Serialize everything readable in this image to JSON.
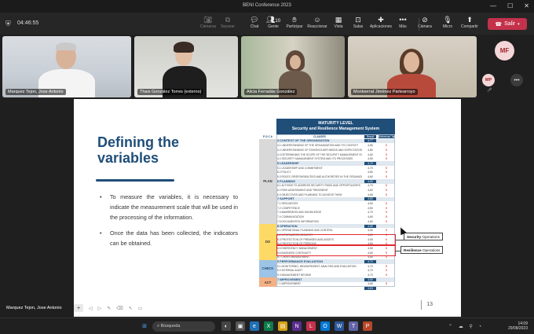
{
  "window": {
    "title": "BENI Conference 2023"
  },
  "toolbar": {
    "timer": "04:46:55",
    "items": [
      {
        "label": "Cámaras",
        "icon": "camera-icon"
      },
      {
        "label": "Separar",
        "icon": "pop-out-icon"
      },
      {
        "label": "Chat",
        "icon": "chat-icon"
      },
      {
        "label": "Gente",
        "icon": "people-icon",
        "count": "10"
      },
      {
        "label": "Participar",
        "icon": "raise-hand-icon"
      },
      {
        "label": "Reaccionar",
        "icon": "smile-icon"
      },
      {
        "label": "Vista",
        "icon": "grid-view-icon"
      },
      {
        "label": "Salas",
        "icon": "breakout-rooms-icon"
      },
      {
        "label": "Aplicaciones",
        "icon": "apps-icon"
      },
      {
        "label": "Más",
        "icon": "more-icon"
      },
      {
        "label": "Cámara",
        "icon": "camera-off-icon"
      },
      {
        "label": "Micro",
        "icon": "mic-off-icon"
      },
      {
        "label": "Compartir",
        "icon": "share-screen-icon"
      }
    ],
    "leave_label": "Salir"
  },
  "participants": [
    {
      "name": "Marquez Tejon, Jose Antonio"
    },
    {
      "name": "Thais González Torres (externo)"
    },
    {
      "name": "Alicia Ferradás González"
    },
    {
      "name": "Montserrat Jiménez Partearroyo"
    }
  ],
  "side_participants": [
    {
      "initials": "MF"
    },
    {
      "initials": "MP"
    }
  ],
  "slide": {
    "title_line1": "Defining the",
    "title_line2": "variables",
    "bullets": [
      "To measure the variables, it is necessary to indicate the measurement scale that will be used in the processing of the information.",
      "Once the data has been collected, the indicators can be obtained."
    ],
    "page_number": "13",
    "table": {
      "title_line1": "MATURITY LEVEL",
      "title_line2": "Security and Resilience Management System",
      "pdca_label": "P D C A",
      "clauses_label": "CLAUSES",
      "col1_label": "Result",
      "col2_label": "Reference Target",
      "phases": [
        "PLAN",
        "DO",
        "CHECK",
        "ACT"
      ],
      "rows": [
        {
          "type": "sec",
          "label": "4 CONTEXT OF THE ORGANIZATION",
          "v1": "4,77",
          "v2": ""
        },
        {
          "type": "row",
          "label": "4.1 UNDERSTANDING OF THE ORGANIZATION AND ITS CONTEXT",
          "v1": "4,80",
          "v2": "5"
        },
        {
          "type": "row",
          "label": "4.2 UNDERSTANDING OF STAKEHOLDER NEEDS AND EXPECTATIONS",
          "v1": "4,80",
          "v2": "5"
        },
        {
          "type": "row",
          "label": "4.3 DETERMINING THE SCOPE OF THE SECURITY MANAGEMENT SYSTEM",
          "v1": "4,60",
          "v2": "5"
        },
        {
          "type": "row",
          "label": "4.4 SECURITY MANAGEMENT SYSTEM AND ITS PROCESSES",
          "v1": "4,90",
          "v2": "5"
        },
        {
          "type": "sec",
          "label": "5 LEADERSHIP",
          "v1": "4,70",
          "v2": ""
        },
        {
          "type": "row",
          "label": "5.1 LEADERSHIP AND COMMITMENT",
          "v1": "4,70",
          "v2": "5"
        },
        {
          "type": "row",
          "label": "5.2 POLICY",
          "v1": "4,80",
          "v2": "5"
        },
        {
          "type": "row",
          "label": "5.3 ROLES, RESPONSIBILITIES AND AUTHORITIES IN THE ORGANIZATION",
          "v1": "4,60",
          "v2": "5"
        },
        {
          "type": "sec",
          "label": "6 PLANNING",
          "v1": "4,65",
          "v2": ""
        },
        {
          "type": "row",
          "label": "6.1 ACTIONS TO ADDRESS SECURITY RISKS AND OPPORTUNITIES",
          "v1": "4,70",
          "v2": "5"
        },
        {
          "type": "row",
          "label": "6.2 RISK ASSESSMENT AND TREATMENT",
          "v1": "4,60",
          "v2": "5"
        },
        {
          "type": "row",
          "label": "6.3 OBJECTIVES AND PLANNING TO ACHIEVE THEM",
          "v1": "4,65",
          "v2": "5"
        },
        {
          "type": "sec",
          "label": "7 SUPPORT",
          "v1": "4,60",
          "v2": ""
        },
        {
          "type": "row",
          "label": "7.1 RESOURCES",
          "v1": "4,60",
          "v2": "5"
        },
        {
          "type": "row",
          "label": "7.2 COMPETENCE",
          "v1": "4,50",
          "v2": "5"
        },
        {
          "type": "row",
          "label": "7.3 AWARENESS AND KNOWLEDGE",
          "v1": "4,70",
          "v2": "5"
        },
        {
          "type": "row",
          "label": "7.4 COMMUNICATION",
          "v1": "4,60",
          "v2": "5"
        },
        {
          "type": "row",
          "label": "7.5 DOCUMENTED INFORMATION",
          "v1": "4,60",
          "v2": "5"
        },
        {
          "type": "sec",
          "label": "8 OPERATION",
          "v1": "4,55",
          "v2": ""
        },
        {
          "type": "row",
          "label": "8.1 OPERATIONAL PLANNING AND CONTROL",
          "v1": "4,50",
          "v2": "5"
        },
        {
          "type": "row",
          "label": "8.2 INFORMATION SECURITY",
          "v1": "4,60",
          "v2": "5"
        },
        {
          "type": "row",
          "label": "8.3 PROTECTION OF PREMISES AND ASSETS",
          "v1": "4,50",
          "v2": "5"
        },
        {
          "type": "row",
          "label": "8.4 PROTECTION OF PERSONS",
          "v1": "4,60",
          "v2": "5"
        },
        {
          "type": "row",
          "label": "8.5 EMERGENCY MANAGEMENT",
          "v1": "4,50",
          "v2": "5"
        },
        {
          "type": "row",
          "label": "8.6 BUSINESS CONTINUITY",
          "v1": "4,60",
          "v2": "5"
        },
        {
          "type": "row",
          "label": "8.7 CRISIS MANAGEMENT",
          "v1": "4,50",
          "v2": "5"
        },
        {
          "type": "sec",
          "label": "9 PERFORMANCE EVALUATION",
          "v1": "4,70",
          "v2": ""
        },
        {
          "type": "row",
          "label": "9.1 MONITORING, MEASUREMENT, ANALYSIS AND EVALUATION",
          "v1": "4,70",
          "v2": "5"
        },
        {
          "type": "row",
          "label": "9.2 INTERNAL AUDIT",
          "v1": "4,70",
          "v2": "5"
        },
        {
          "type": "row",
          "label": "9.3 MANAGEMENT REVIEW",
          "v1": "4,70",
          "v2": "5"
        },
        {
          "type": "sec",
          "label": "7 IMPROVEMENT",
          "v1": "4,60",
          "v2": ""
        },
        {
          "type": "row",
          "label": "7.1 IMPROVEMENT",
          "v1": "4,60",
          "v2": "5"
        },
        {
          "type": "tot",
          "label": "",
          "v1": "4,63",
          "v2": ""
        }
      ],
      "callouts": [
        {
          "bold": "Security",
          "rest": " Operations"
        },
        {
          "bold": "Resilience",
          "rest": " Operations"
        }
      ]
    }
  },
  "presenter_label": "Marquez Tejon, Jose Antonio",
  "taskbar": {
    "search_placeholder": "Búsqueda",
    "time": "14:09",
    "date": "29/08/2023"
  },
  "colors": {
    "accent": "#1f4e79",
    "leave": "#c4314b",
    "teams_purple": "#6264a7",
    "highlight_red": "#e0282e"
  }
}
